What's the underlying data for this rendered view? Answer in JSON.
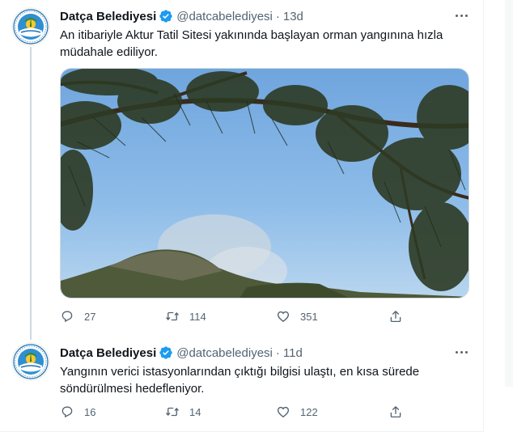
{
  "tweets": [
    {
      "name": "Datça Belediyesi",
      "handle": "@datcabelediyesi",
      "separator": "·",
      "time": "13d",
      "text": "An itibariyle Aktur Tatil Sitesi yakınında başlayan orman yangınına hızla müdahale ediliyor.",
      "stats": {
        "replies": "27",
        "retweets": "114",
        "likes": "351"
      }
    },
    {
      "name": "Datça Belediyesi",
      "handle": "@datcabelediyesi",
      "separator": "·",
      "time": "11d",
      "text": "Yangının verici istasyonlarından çıktığı bilgisi ulaştı, en kısa sürede söndürülmesi hedefleniyor.",
      "stats": {
        "replies": "16",
        "retweets": "14",
        "likes": "122"
      }
    }
  ],
  "colors": {
    "verified": "#1d9bf0",
    "muted": "#536471",
    "text": "#0f1419",
    "sky": "#86b4e3"
  },
  "icons": [
    "verified-badge-icon",
    "more-icon",
    "reply-icon",
    "retweet-icon",
    "like-icon",
    "share-icon"
  ]
}
